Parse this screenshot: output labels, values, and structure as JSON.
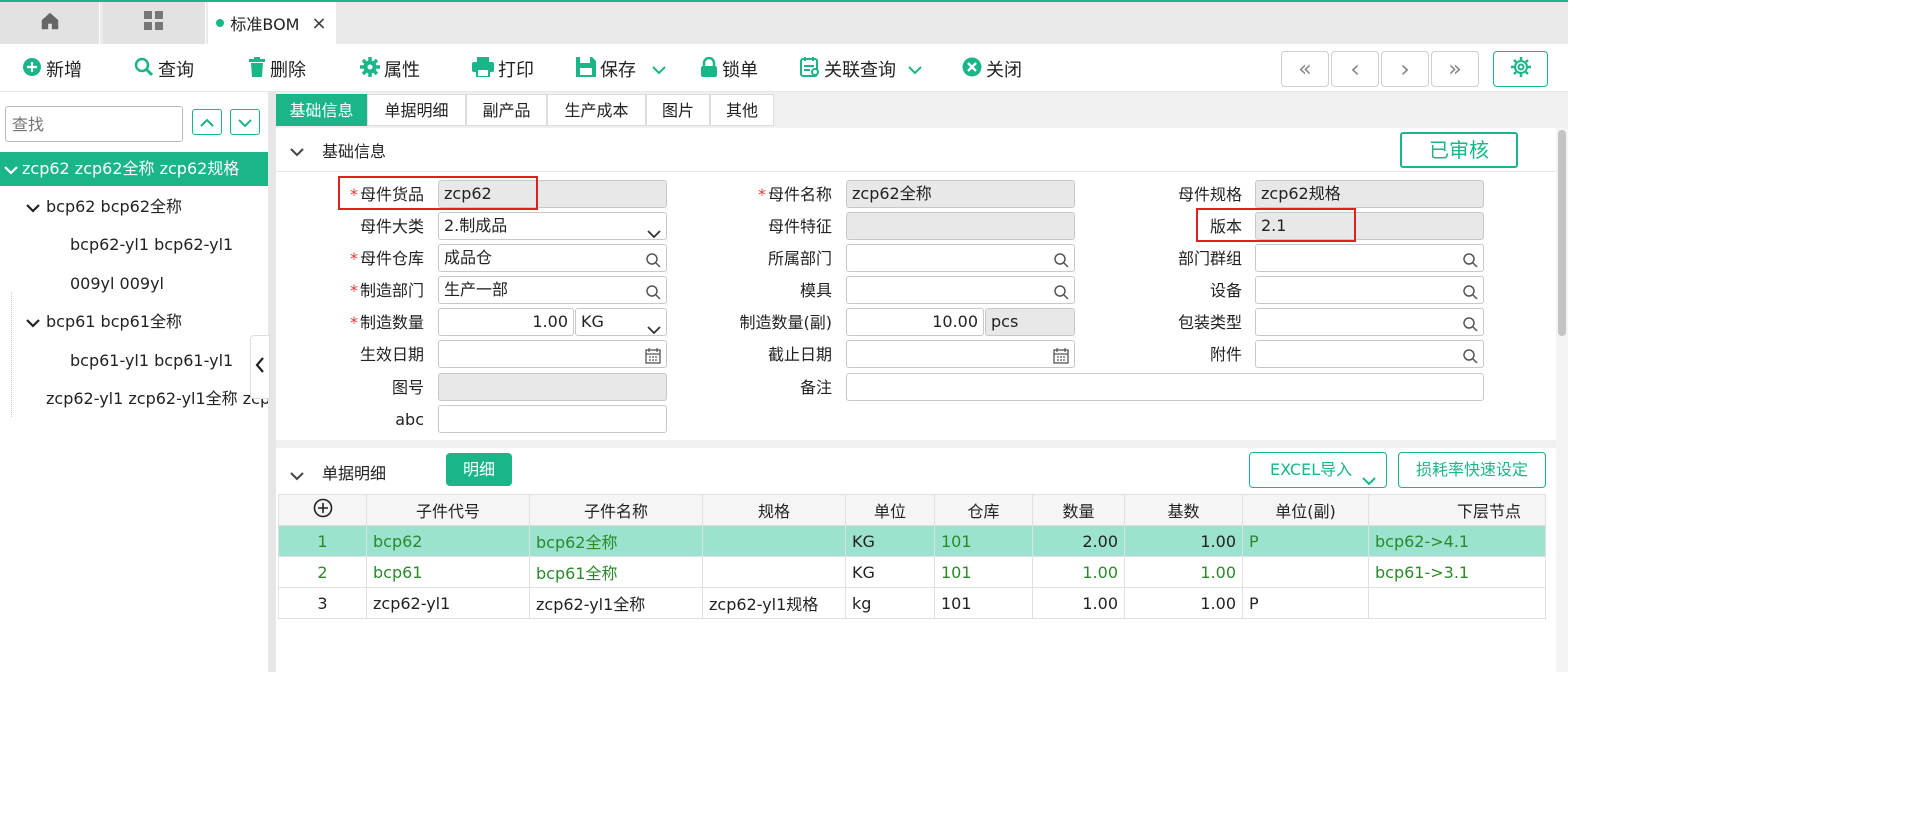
{
  "tabs": {
    "home_title": "",
    "apps_title": "",
    "active_label": "标准BOM",
    "close_glyph": "×"
  },
  "toolbar": {
    "add": "新增",
    "query": "查询",
    "delete": "删除",
    "props": "属性",
    "print": "打印",
    "save": "保存",
    "lock": "锁单",
    "related": "关联查询",
    "close": "关闭",
    "nav_first": "«",
    "nav_prev": "‹",
    "nav_next": "›",
    "nav_last": "»"
  },
  "sidebar": {
    "search_placeholder": "查找",
    "nodes": [
      {
        "label": "zcp62 zcp62全称 zcp62规格"
      },
      {
        "label": "bcp62 bcp62全称"
      },
      {
        "label": "bcp62-yl1 bcp62-yl1"
      },
      {
        "label": "009yl 009yl"
      },
      {
        "label": "bcp61 bcp61全称"
      },
      {
        "label": "bcp61-yl1 bcp61-yl1"
      },
      {
        "label": "zcp62-yl1 zcp62-yl1全称 zcp"
      }
    ]
  },
  "subtabs": [
    "基础信息",
    "单据明细",
    "副产品",
    "生产成本",
    "图片",
    "其他"
  ],
  "basic": {
    "section_title": "基础信息",
    "status": "已审核",
    "req_mark": "*",
    "fields": {
      "parent_code": {
        "label": "母件货品",
        "value": "zcp62"
      },
      "parent_name": {
        "label": "母件名称",
        "value": "zcp62全称"
      },
      "parent_spec": {
        "label": "母件规格",
        "value": "zcp62规格"
      },
      "parent_cat": {
        "label": "母件大类",
        "value": "2.制成品"
      },
      "parent_feature": {
        "label": "母件特征",
        "value": ""
      },
      "version": {
        "label": "版本",
        "value": "2.1"
      },
      "warehouse": {
        "label": "母件仓库",
        "value": "成品仓"
      },
      "dept": {
        "label": "所属部门",
        "value": ""
      },
      "dept_group": {
        "label": "部门群组",
        "value": ""
      },
      "mfg_dept": {
        "label": "制造部门",
        "value": "生产一部"
      },
      "mold": {
        "label": "模具",
        "value": ""
      },
      "device": {
        "label": "设备",
        "value": ""
      },
      "mfg_qty": {
        "label": "制造数量",
        "value": "1.00",
        "unit": "KG"
      },
      "mfg_qty2": {
        "label": "制造数量(副)",
        "value": "10.00",
        "unit": "pcs"
      },
      "pack_type": {
        "label": "包装类型",
        "value": ""
      },
      "eff_date": {
        "label": "生效日期",
        "value": ""
      },
      "end_date": {
        "label": "截止日期",
        "value": ""
      },
      "attach": {
        "label": "附件",
        "value": ""
      },
      "drawing": {
        "label": "图号",
        "value": ""
      },
      "remark": {
        "label": "备注",
        "value": ""
      },
      "abc": {
        "label": "abc",
        "value": ""
      }
    }
  },
  "detail": {
    "section_title": "单据明细",
    "detail_btn": "明细",
    "excel_btn": "EXCEL导入",
    "loss_btn": "损耗率快速设定",
    "columns": [
      "",
      "子件代号",
      "子件名称",
      "规格",
      "单位",
      "仓库",
      "数量",
      "基数",
      "单位(副)",
      "下层节点"
    ],
    "rows": [
      {
        "no": "1",
        "code": "bcp62",
        "name": "bcp62全称",
        "spec": "",
        "unit": "KG",
        "wh": "101",
        "qty": "2.00",
        "base": "1.00",
        "unit2": "P",
        "node": "bcp62->4.1"
      },
      {
        "no": "2",
        "code": "bcp61",
        "name": "bcp61全称",
        "spec": "",
        "unit": "KG",
        "wh": "101",
        "qty": "1.00",
        "base": "1.00",
        "unit2": "",
        "node": "bcp61->3.1"
      },
      {
        "no": "3",
        "code": "zcp62-yl1",
        "name": "zcp62-yl1全称",
        "spec": "zcp62-yl1规格",
        "unit": "kg",
        "wh": "101",
        "qty": "1.00",
        "base": "1.00",
        "unit2": "P",
        "node": ""
      }
    ]
  },
  "colors": {
    "accent": "#1bb58a",
    "highlight": "#e02020",
    "selected_row": "#9be3cf",
    "child_text": "#2a8a2a"
  }
}
